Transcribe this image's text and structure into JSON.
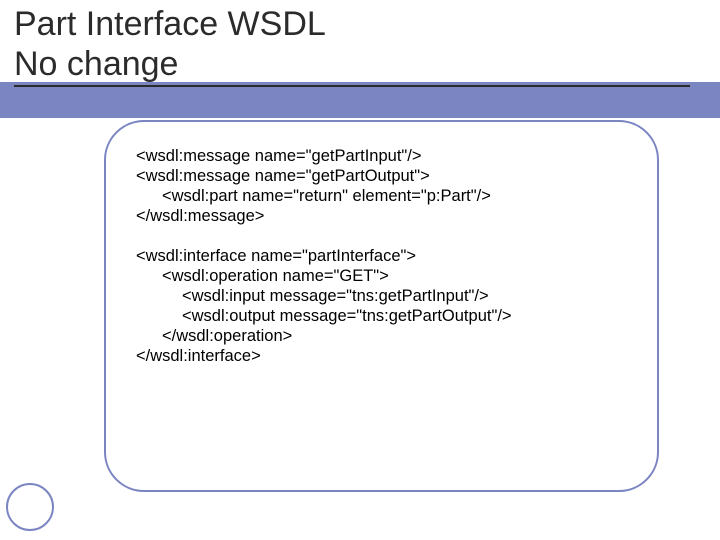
{
  "title": {
    "line1": "Part Interface WSDL",
    "line2": "No change"
  },
  "code": {
    "b1": {
      "l1": "<wsdl:message name=\"getPartInput\"/>",
      "l2": "<wsdl:message name=\"getPartOutput\">",
      "l3": "<wsdl:part name=\"return\" element=\"p:Part\"/>",
      "l4": "</wsdl:message>"
    },
    "b2": {
      "l1": "<wsdl:interface name=\"partInterface\">",
      "l2": "<wsdl:operation name=\"GET\">",
      "l3": "<wsdl:input message=\"tns:getPartInput\"/>",
      "l4": "<wsdl:output message=\"tns:getPartOutput\"/>",
      "l5": "</wsdl:operation>",
      "l6": "</wsdl:interface>"
    }
  }
}
